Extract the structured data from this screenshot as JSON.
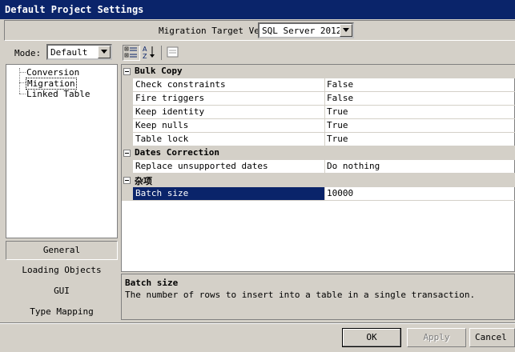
{
  "window": {
    "title": "Default Project Settings"
  },
  "target": {
    "label": "Migration Target Vers",
    "value": "SQL Server 2012"
  },
  "mode": {
    "label": "Mode:",
    "value": "Default"
  },
  "tree": {
    "items": [
      "Conversion",
      "Migration",
      "Linked Table"
    ],
    "selected": "Migration"
  },
  "nav": {
    "items": [
      "General",
      "Loading Objects",
      "GUI",
      "Type Mapping"
    ],
    "active": "General"
  },
  "grid": {
    "categories": [
      {
        "name": "Bulk Copy",
        "props": [
          {
            "name": "Check constraints",
            "value": "False"
          },
          {
            "name": "Fire triggers",
            "value": "False"
          },
          {
            "name": "Keep identity",
            "value": "True"
          },
          {
            "name": "Keep nulls",
            "value": "True"
          },
          {
            "name": "Table lock",
            "value": "True"
          }
        ]
      },
      {
        "name": "Dates Correction",
        "props": [
          {
            "name": "Replace unsupported dates",
            "value": "Do nothing"
          }
        ]
      },
      {
        "name": "杂项",
        "props": [
          {
            "name": "Batch size",
            "value": "10000"
          }
        ]
      }
    ]
  },
  "description": {
    "title": "Batch size",
    "text": "The number of rows to insert into a table in a single transaction."
  },
  "buttons": {
    "ok": "OK",
    "apply": "Apply",
    "cancel": "Cancel"
  },
  "icons": {
    "categorized": "categorized-icon",
    "alphabetical": "sort-az-icon",
    "property_pages": "property-pages-icon"
  },
  "colors": {
    "titlebar": "#0a246a",
    "selection": "#0a246a",
    "face": "#d4d0c8"
  }
}
